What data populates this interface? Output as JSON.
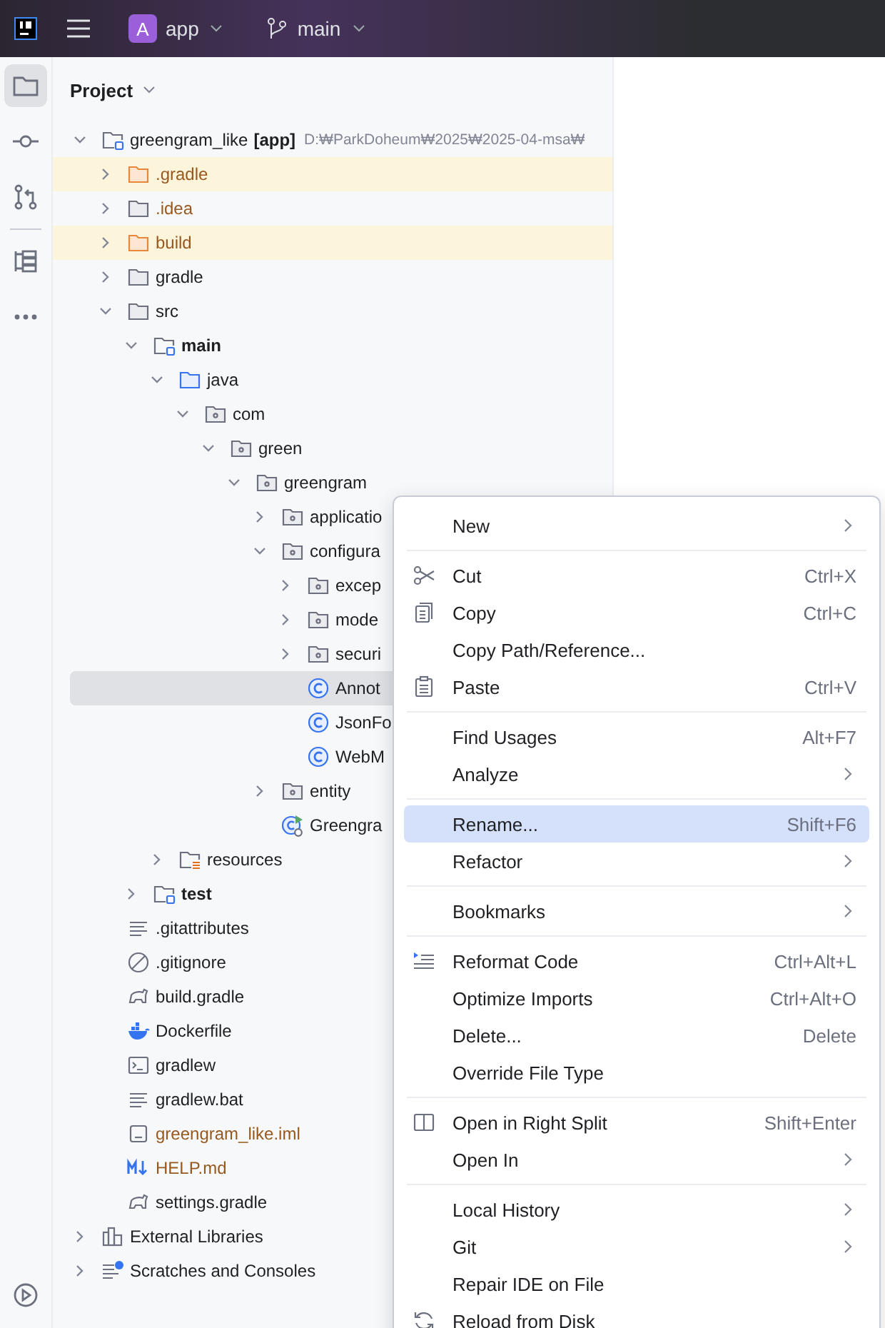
{
  "topbar": {
    "project_initial": "A",
    "project": "app",
    "branch": "main"
  },
  "toolbar": {
    "items": [
      {
        "kind": "folder",
        "selected": true
      },
      {
        "kind": "commit",
        "selected": false
      },
      {
        "kind": "pull-requests",
        "selected": false
      },
      {
        "kind": "structure",
        "selected": false
      },
      {
        "kind": "more",
        "selected": false
      }
    ],
    "bottom": [
      {
        "kind": "run",
        "selected": false
      }
    ]
  },
  "panel": {
    "title": "Project"
  },
  "tree": [
    {
      "name": "greengram_like",
      "module": "[app]",
      "path": "D:₩ParkDoheum₩2025₩2025-04-msa₩",
      "kind": "root",
      "expanded": true,
      "selected": false,
      "children": [
        {
          "name": ".gradle",
          "kind": "folder",
          "excluded": true,
          "ignored": true,
          "expanded": false,
          "selected": false
        },
        {
          "name": ".idea",
          "kind": "folder",
          "excluded": false,
          "ignored": true,
          "expanded": false,
          "selected": false
        },
        {
          "name": "build",
          "kind": "folder",
          "excluded": true,
          "ignored": true,
          "expanded": false,
          "selected": false
        },
        {
          "name": "gradle",
          "kind": "folder",
          "excluded": false,
          "ignored": false,
          "expanded": false,
          "selected": false
        },
        {
          "name": "src",
          "kind": "folder",
          "excluded": false,
          "ignored": false,
          "expanded": true,
          "selected": false,
          "children": [
            {
              "name": "main",
              "kind": "module",
              "expanded": true,
              "selected": false,
              "children": [
                {
                  "name": "java",
                  "kind": "source",
                  "expanded": true,
                  "selected": false,
                  "children": [
                    {
                      "name": "com",
                      "kind": "package",
                      "expanded": true,
                      "selected": false,
                      "children": [
                        {
                          "name": "green",
                          "kind": "package",
                          "expanded": true,
                          "selected": false,
                          "children": [
                            {
                              "name": "greengram",
                              "kind": "package",
                              "expanded": true,
                              "selected": false,
                              "children": [
                                {
                                  "name": "applicatio",
                                  "kind": "package",
                                  "expanded": false,
                                  "selected": false
                                },
                                {
                                  "name": "configura",
                                  "kind": "package",
                                  "expanded": true,
                                  "selected": false,
                                  "children": [
                                    {
                                      "name": "excep",
                                      "kind": "package",
                                      "expanded": false,
                                      "selected": false
                                    },
                                    {
                                      "name": "mode",
                                      "kind": "package",
                                      "expanded": false,
                                      "selected": false
                                    },
                                    {
                                      "name": "securi",
                                      "kind": "package",
                                      "expanded": false,
                                      "selected": false
                                    },
                                    {
                                      "name": "Annot",
                                      "kind": "class",
                                      "selected": true
                                    },
                                    {
                                      "name": "JsonFo",
                                      "kind": "class",
                                      "selected": false
                                    },
                                    {
                                      "name": "WebM",
                                      "kind": "class",
                                      "selected": false
                                    }
                                  ]
                                },
                                {
                                  "name": "entity",
                                  "kind": "package",
                                  "expanded": false,
                                  "selected": false
                                },
                                {
                                  "name": "Greengra",
                                  "kind": "spring",
                                  "selected": false
                                }
                              ]
                            }
                          ]
                        }
                      ]
                    }
                  ]
                },
                {
                  "name": "resources",
                  "kind": "resources",
                  "expanded": false,
                  "selected": false
                }
              ]
            },
            {
              "name": "test",
              "kind": "module",
              "expanded": false,
              "selected": false
            }
          ]
        },
        {
          "name": ".gitattributes",
          "kind": "text",
          "selected": false
        },
        {
          "name": ".gitignore",
          "kind": "ignore",
          "selected": false
        },
        {
          "name": "build.gradle",
          "kind": "gradle",
          "selected": false
        },
        {
          "name": "Dockerfile",
          "kind": "docker",
          "selected": false
        },
        {
          "name": "gradlew",
          "kind": "terminal",
          "selected": false
        },
        {
          "name": "gradlew.bat",
          "kind": "text",
          "selected": false
        },
        {
          "name": "greengram_like.iml",
          "kind": "iml",
          "ignored": true,
          "selected": false
        },
        {
          "name": "HELP.md",
          "kind": "markdown",
          "ignored": true,
          "selected": false
        },
        {
          "name": "settings.gradle",
          "kind": "gradle",
          "selected": false
        }
      ]
    },
    {
      "name": "External Libraries",
      "kind": "library",
      "expanded": false,
      "selected": false
    },
    {
      "name": "Scratches and Consoles",
      "kind": "scratches",
      "expanded": false,
      "selected": false
    }
  ],
  "context_menu": [
    [
      {
        "label": "New",
        "submenu": true,
        "selected": false
      }
    ],
    [
      {
        "label": "Cut",
        "kind": "scissors",
        "shortcut": "Ctrl+X",
        "selected": false
      },
      {
        "label": "Copy",
        "kind": "copy",
        "shortcut": "Ctrl+C",
        "selected": false
      },
      {
        "label": "Copy Path/Reference...",
        "selected": false
      },
      {
        "label": "Paste",
        "kind": "paste",
        "shortcut": "Ctrl+V",
        "selected": false
      }
    ],
    [
      {
        "label": "Find Usages",
        "shortcut": "Alt+F7",
        "selected": false
      },
      {
        "label": "Analyze",
        "submenu": true,
        "selected": false
      }
    ],
    [
      {
        "label": "Rename...",
        "shortcut": "Shift+F6",
        "selected": true
      },
      {
        "label": "Refactor",
        "submenu": true,
        "selected": false
      }
    ],
    [
      {
        "label": "Bookmarks",
        "submenu": true,
        "selected": false
      }
    ],
    [
      {
        "label": "Reformat Code",
        "kind": "reformat",
        "shortcut": "Ctrl+Alt+L",
        "selected": false
      },
      {
        "label": "Optimize Imports",
        "shortcut": "Ctrl+Alt+O",
        "selected": false
      },
      {
        "label": "Delete...",
        "shortcut": "Delete",
        "selected": false
      },
      {
        "label": "Override File Type",
        "selected": false
      }
    ],
    [
      {
        "label": "Open in Right Split",
        "kind": "split",
        "shortcut": "Shift+Enter",
        "selected": false
      },
      {
        "label": "Open In",
        "submenu": true,
        "selected": false
      }
    ],
    [
      {
        "label": "Local History",
        "submenu": true,
        "selected": false
      },
      {
        "label": "Git",
        "submenu": true,
        "selected": false
      },
      {
        "label": "Repair IDE on File",
        "selected": false
      },
      {
        "label": "Reload from Disk",
        "kind": "reload",
        "selected": false
      }
    ]
  ]
}
